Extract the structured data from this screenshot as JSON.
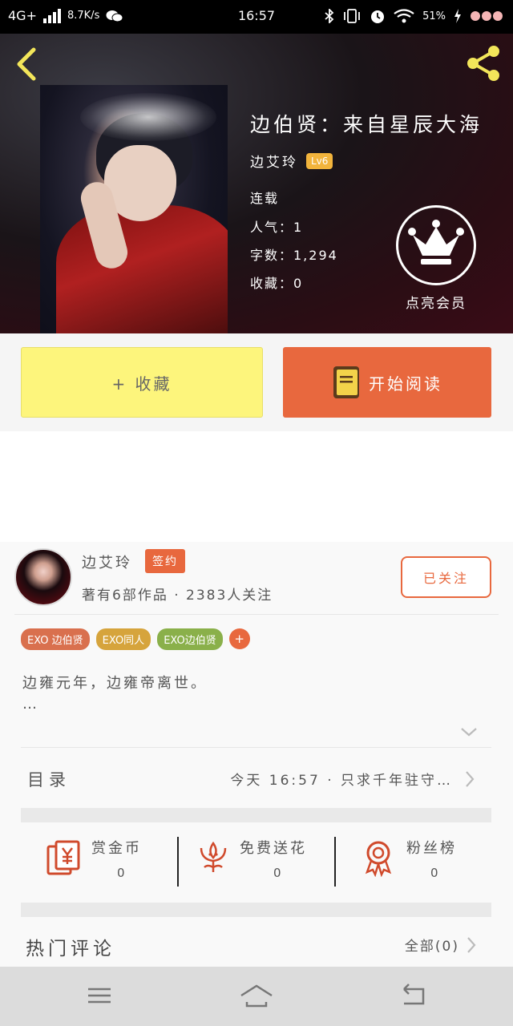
{
  "status_bar": {
    "network": "4G+",
    "speed": "8.7K/s",
    "time": "16:57",
    "battery": "51%"
  },
  "book": {
    "title": "边伯贤：来自星辰大海",
    "author": "边艾玲",
    "level": "Lv6",
    "status": "连载",
    "popularity": "人气：1",
    "word_count": "字数：1,294",
    "favorites": "收藏：0",
    "vip_label": "点亮会员"
  },
  "actions": {
    "collect_label": "+ 收藏",
    "read_label": "开始阅读"
  },
  "author_card": {
    "name": "边艾玲",
    "badge": "签约",
    "works": "著有6部作品 · 2383人关注",
    "follow_label": "已关注"
  },
  "tags": [
    {
      "label": "EXO 边伯贤",
      "color": "#d9704e"
    },
    {
      "label": "EXO同人",
      "color": "#d6a43c"
    },
    {
      "label": "EXO边伯贤",
      "color": "#8ab04a"
    }
  ],
  "tag_add": "+",
  "synopsis": "边雍元年，边雍帝离世。",
  "synopsis_more": "…",
  "toc": {
    "label": "目录",
    "latest": "今天 16:57 · 只求千年驻守…"
  },
  "stats": [
    {
      "label": "赏金币",
      "count": "0",
      "icon": "reward-coin-icon"
    },
    {
      "label": "免费送花",
      "count": "0",
      "icon": "flower-icon"
    },
    {
      "label": "粉丝榜",
      "count": "0",
      "icon": "fan-ranking-icon"
    }
  ],
  "comments": {
    "title": "热门评论",
    "all_label": "全部(0)"
  },
  "colors": {
    "accent": "#e8683e",
    "collect_bg": "#fdf57c",
    "level_badge": "#f2b43c"
  }
}
